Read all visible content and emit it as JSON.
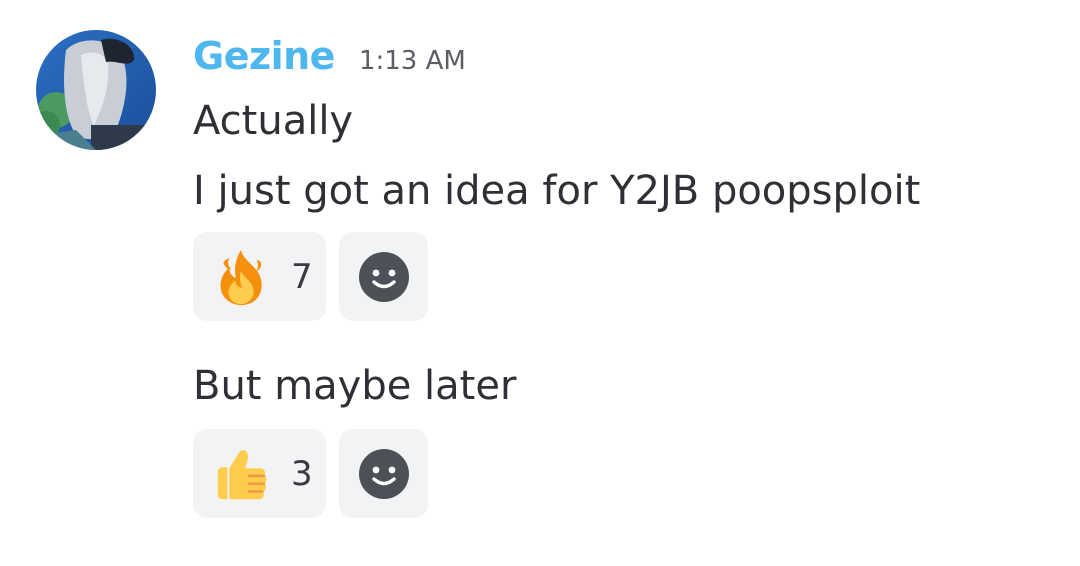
{
  "message": {
    "author": "Gezine",
    "timestamp": "1:13 AM",
    "lines": [
      "Actually",
      "I just got an idea for Y2JB poopsploit",
      "But maybe later"
    ],
    "reactions_first": [
      {
        "emoji": "fire-icon",
        "count": "7"
      }
    ],
    "reactions_second": [
      {
        "emoji": "thumbs-up-icon",
        "count": "3"
      }
    ]
  },
  "colors": {
    "username": "#4fb7f0",
    "timestamp": "#5c5e66",
    "text": "#2e3035",
    "reaction_bg": "#f2f3f5",
    "add_reaction_icon": "#4e5058"
  }
}
